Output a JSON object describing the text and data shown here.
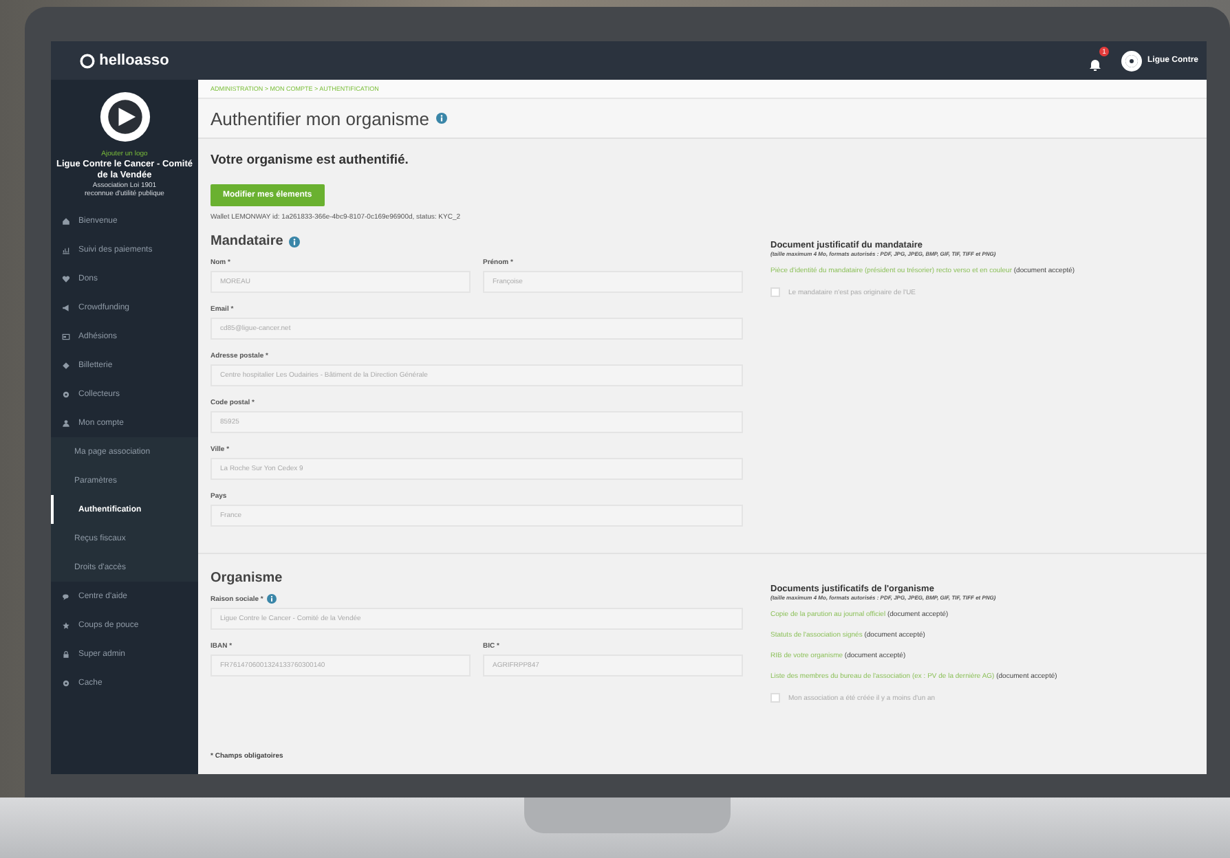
{
  "topbar": {
    "logo": "helloasso",
    "notifications": "1",
    "user": "Ligue Contre"
  },
  "profile": {
    "add_logo": "Ajouter un logo",
    "name": "Ligue Contre le Cancer - Comité de la Vendée",
    "line_1": "Association Loi 1901",
    "line_2": "reconnue d'utilité publique"
  },
  "sidebar": {
    "items": [
      {
        "label": "Bienvenue",
        "selected": false
      },
      {
        "label": "Suivi des paiements",
        "selected": false
      },
      {
        "label": "Dons",
        "selected": false
      },
      {
        "label": "Crowdfunding",
        "selected": false
      },
      {
        "label": "Adhésions",
        "selected": false
      },
      {
        "label": "Billetterie",
        "selected": false
      },
      {
        "label": "Collecteurs",
        "selected": false
      },
      {
        "label": "Mon compte",
        "selected": false,
        "children": [
          {
            "label": "Ma page association",
            "selected": false
          },
          {
            "label": "Paramètres",
            "selected": false
          },
          {
            "label": "Authentification",
            "selected": true
          },
          {
            "label": "Reçus fiscaux",
            "selected": false
          },
          {
            "label": "Droits d'accès",
            "selected": false
          }
        ]
      },
      {
        "label": "Centre d'aide",
        "selected": false
      },
      {
        "label": "Coups de pouce",
        "selected": false
      },
      {
        "label": "Super admin",
        "selected": false
      },
      {
        "label": "Cache",
        "selected": false
      }
    ]
  },
  "breadcrumb": "ADMINISTRATION > MON COMPTE > AUTHENTIFICATION",
  "title": "Authentifier mon organisme",
  "status": "Votre organisme est authentifié.",
  "edit_button": "Modifier mes élements",
  "wallet": "Wallet LEMONWAY id: 1a261833-366e-4bc9-8107-0c169e96900d, status: KYC_2",
  "sections": [
    {
      "title": "Mandataire",
      "info": true,
      "rows": [
        [
          {
            "label": "Nom *",
            "value": "MOREAU",
            "info": false
          },
          {
            "label": "Prénom *",
            "value": "Françoise",
            "info": false
          }
        ],
        [
          {
            "label": "Email *",
            "value": "cd85@ligue-cancer.net",
            "info": false
          }
        ],
        [
          {
            "label": "Adresse postale *",
            "value": "Centre hospitalier Les  Oudairies - Bâtiment de la Direction Générale",
            "info": false
          }
        ],
        [
          {
            "label": "Code postal *",
            "value": "85925",
            "info": false
          }
        ],
        [
          {
            "label": "Ville *",
            "value": "La Roche Sur Yon Cedex 9",
            "info": false
          }
        ],
        [
          {
            "label": "Pays",
            "value": "France",
            "info": false
          }
        ]
      ],
      "documents": {
        "title": "Document justificatif du mandataire",
        "note": "(taille maximum 4 Mo, formats autorisés : PDF, JPG, JPEG, BMP, GIF, TIF, TIFF et PNG)",
        "items": [
          {
            "link": "Pièce d'identité du mandataire (président ou trésorier) recto verso et en couleur",
            "status": "(document accepté)"
          }
        ],
        "checkbox": {
          "label": "Le mandataire n'est pas originaire de l'UE",
          "checked": false
        }
      }
    },
    {
      "title": "Organisme",
      "info": false,
      "rows": [
        [
          {
            "label": "Raison sociale *",
            "value": "Ligue Contre le Cancer - Comité de la Vendée",
            "info": true
          }
        ],
        [
          {
            "label": "IBAN *",
            "value": "FR7614706001324133760300140",
            "info": false
          },
          {
            "label": "BIC *",
            "value": "AGRIFRPP847",
            "info": false
          }
        ]
      ],
      "documents": {
        "title": "Documents justificatifs de l'organisme",
        "note": "(taille maximum 4 Mo, formats autorisés : PDF, JPG, JPEG, BMP, GIF, TIF, TIFF et PNG)",
        "items": [
          {
            "link": "Copie de la parution au journal officiel",
            "status": "(document accepté)"
          },
          {
            "link": "Statuts de l'association signés",
            "status": "(document accepté)"
          },
          {
            "link": "RIB de votre organisme",
            "status": "(document accepté)"
          },
          {
            "link": "Liste des membres du bureau de l'association (ex : PV de la dernière AG)",
            "status": "(document accepté)"
          }
        ],
        "checkbox": {
          "label": "Mon association a été créée il y a moins d'un an",
          "checked": false
        }
      }
    }
  ],
  "footnote": "* Champs obligatoires"
}
